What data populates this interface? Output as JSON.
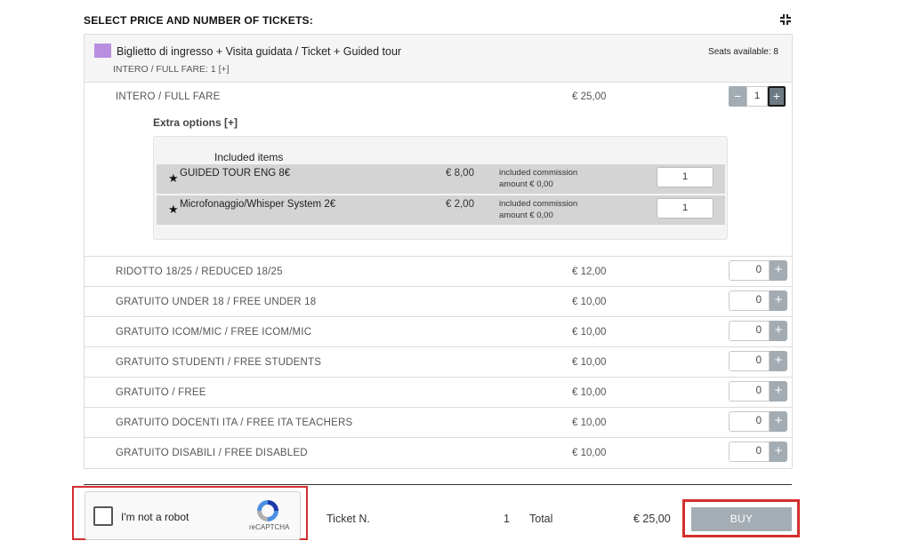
{
  "header": {
    "title": "SELECT PRICE AND NUMBER OF TICKETS:"
  },
  "ticket": {
    "name": "Biglietto di ingresso + Visita guidata / Ticket + Guided tour",
    "summary": "INTERO / FULL FARE: 1 [+]",
    "seats": "Seats available: 8",
    "color": "#b98ee0"
  },
  "full_fare": {
    "label": "INTERO / FULL FARE",
    "price": "€ 25,00",
    "quantity": "1",
    "minus": "−",
    "plus": "+"
  },
  "extra_options": {
    "title": "Extra options [+]",
    "included_title": "Included items",
    "items": [
      {
        "star": "★",
        "name": "GUIDED TOUR ENG 8€",
        "price": "€ 8,00",
        "commission_1": "included commission",
        "commission_2": "amount € 0,00",
        "quantity": "1"
      },
      {
        "star": "★",
        "name": "Microfonaggio/Whisper System 2€",
        "price": "€ 2,00",
        "commission_1": "included commission",
        "commission_2": "amount € 0,00",
        "quantity": "1"
      }
    ]
  },
  "fares": [
    {
      "label": "RIDOTTO 18/25 / REDUCED 18/25",
      "price": "€ 12,00",
      "quantity": "0",
      "plus": "+"
    },
    {
      "label": "GRATUITO UNDER 18 / FREE UNDER 18",
      "price": "€ 10,00",
      "quantity": "0",
      "plus": "+"
    },
    {
      "label": "GRATUITO ICOM/MIC / FREE ICOM/MIC",
      "price": "€ 10,00",
      "quantity": "0",
      "plus": "+"
    },
    {
      "label": "GRATUITO STUDENTI / FREE STUDENTS",
      "price": "€ 10,00",
      "quantity": "0",
      "plus": "+"
    },
    {
      "label": "GRATUITO / FREE",
      "price": "€ 10,00",
      "quantity": "0",
      "plus": "+"
    },
    {
      "label": "GRATUITO DOCENTI ITA / FREE ITA TEACHERS",
      "price": "€ 10,00",
      "quantity": "0",
      "plus": "+"
    },
    {
      "label": "GRATUITO DISABILI / FREE DISABLED",
      "price": "€ 10,00",
      "quantity": "0",
      "plus": "+"
    }
  ],
  "captcha": {
    "label": "I'm not a robot",
    "brand": "reCAPTCHA"
  },
  "summary": {
    "ticket_label": "Ticket N.",
    "ticket_count": "1",
    "total_label": "Total",
    "total_value": "€ 25,00",
    "buy_label": "BUY"
  },
  "colors": {
    "highlight": "#d32f2f",
    "button": "#a4adb4"
  }
}
